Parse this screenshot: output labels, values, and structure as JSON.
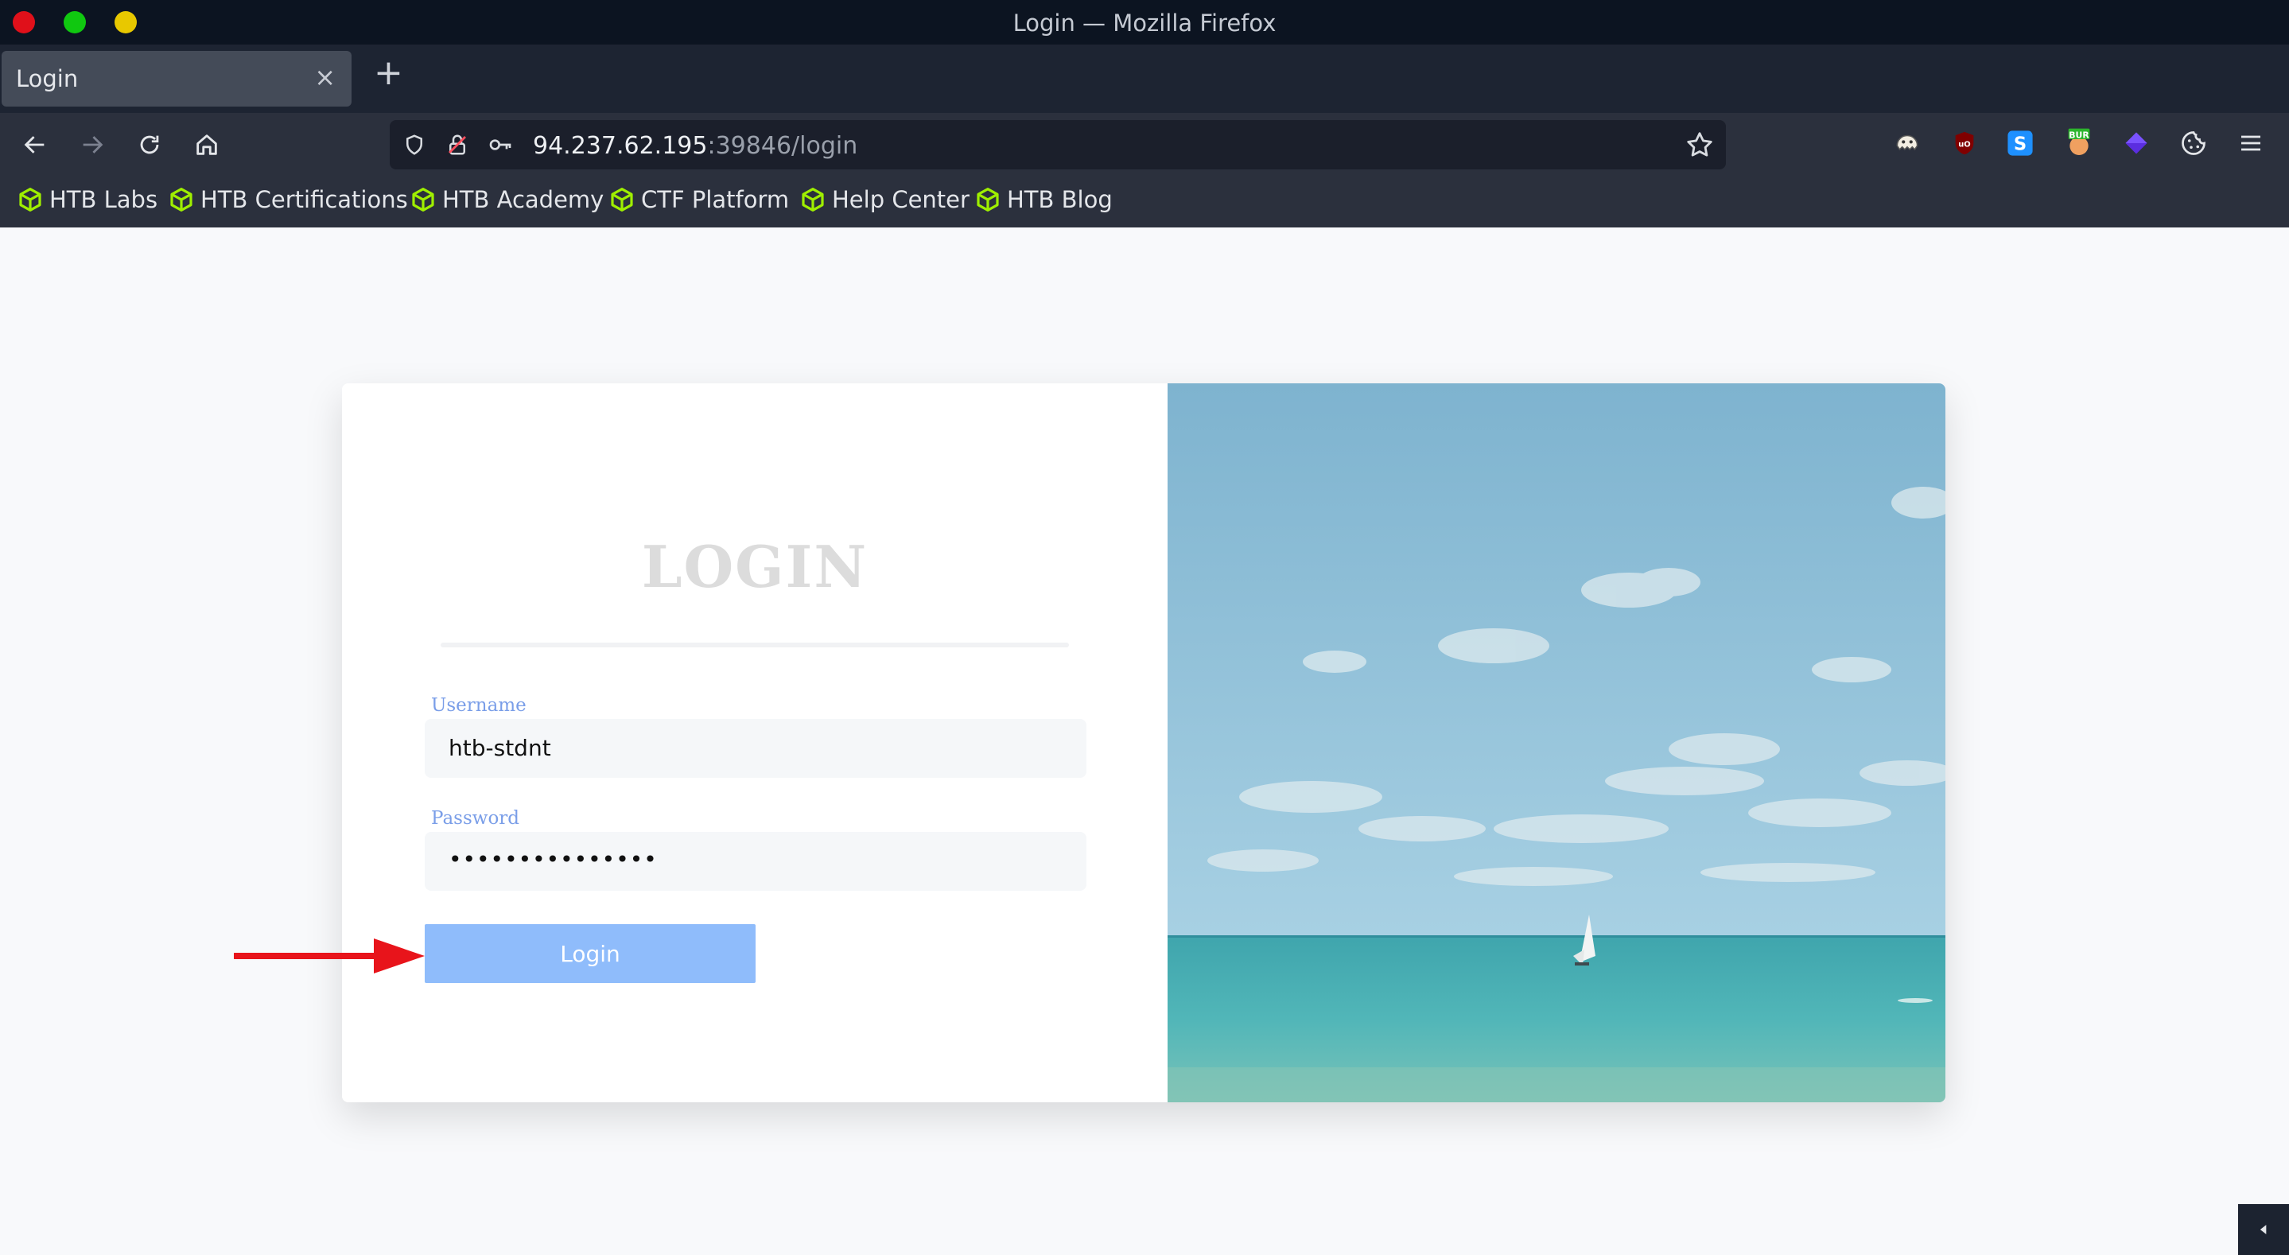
{
  "window": {
    "title": "Login — Mozilla Firefox"
  },
  "tab": {
    "label": "Login",
    "close_symbol": "×",
    "new_tab_symbol": "+"
  },
  "nav": {
    "back_icon": "arrow-left-icon",
    "forward_icon": "arrow-right-icon",
    "reload_icon": "reload-icon",
    "home_icon": "home-icon"
  },
  "url": {
    "host": "94.237.62.195",
    "rest": ":39846/login"
  },
  "extensions": [
    "ghost-extension-icon",
    "ublock-icon",
    "s-extension-icon",
    "burp-extension-icon",
    "purple-gem-icon",
    "cookie-icon",
    "menu-icon"
  ],
  "bookmarks": [
    "HTB Labs",
    "HTB Certifications",
    "HTB Academy",
    "CTF Platform",
    "Help Center",
    "HTB Blog"
  ],
  "login": {
    "heading": "LOGIN",
    "username_label": "Username",
    "username_value": "htb-stdnt",
    "password_label": "Password",
    "password_value": "•••••••••••••••",
    "button_label": "Login"
  },
  "colors": {
    "accent": "#8fbcfb",
    "label": "#7a9ee8",
    "bookmark_icon": "#9fef00",
    "annotation_arrow": "#e8141b"
  }
}
